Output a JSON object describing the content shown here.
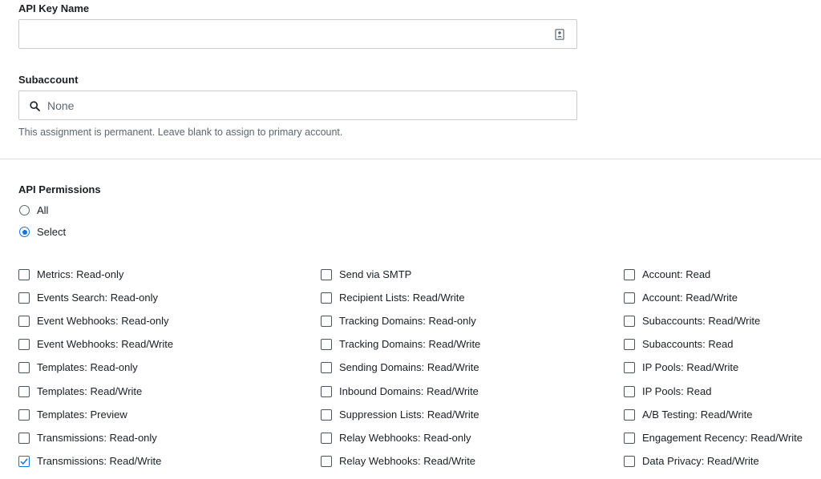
{
  "api_key_name": {
    "label": "API Key Name",
    "value": "",
    "placeholder": ""
  },
  "subaccount": {
    "label": "Subaccount",
    "placeholder": "None",
    "help_text": "This assignment is permanent. Leave blank to assign to primary account."
  },
  "permissions": {
    "heading": "API Permissions",
    "options": [
      {
        "label": "All",
        "selected": false
      },
      {
        "label": "Select",
        "selected": true
      }
    ],
    "columns": [
      [
        {
          "label": "Metrics: Read-only",
          "checked": false
        },
        {
          "label": "Events Search: Read-only",
          "checked": false
        },
        {
          "label": "Event Webhooks: Read-only",
          "checked": false
        },
        {
          "label": "Event Webhooks: Read/Write",
          "checked": false
        },
        {
          "label": "Templates: Read-only",
          "checked": false
        },
        {
          "label": "Templates: Read/Write",
          "checked": false
        },
        {
          "label": "Templates: Preview",
          "checked": false
        },
        {
          "label": "Transmissions: Read-only",
          "checked": false
        },
        {
          "label": "Transmissions: Read/Write",
          "checked": true
        }
      ],
      [
        {
          "label": "Send via SMTP",
          "checked": false
        },
        {
          "label": "Recipient Lists: Read/Write",
          "checked": false
        },
        {
          "label": "Tracking Domains: Read-only",
          "checked": false
        },
        {
          "label": "Tracking Domains: Read/Write",
          "checked": false
        },
        {
          "label": "Sending Domains: Read/Write",
          "checked": false
        },
        {
          "label": "Inbound Domains: Read/Write",
          "checked": false
        },
        {
          "label": "Suppression Lists: Read/Write",
          "checked": false
        },
        {
          "label": "Relay Webhooks: Read-only",
          "checked": false
        },
        {
          "label": "Relay Webhooks: Read/Write",
          "checked": false
        }
      ],
      [
        {
          "label": "Account: Read",
          "checked": false
        },
        {
          "label": "Account: Read/Write",
          "checked": false
        },
        {
          "label": "Subaccounts: Read/Write",
          "checked": false
        },
        {
          "label": "Subaccounts: Read",
          "checked": false
        },
        {
          "label": "IP Pools: Read/Write",
          "checked": false
        },
        {
          "label": "IP Pools: Read",
          "checked": false
        },
        {
          "label": "A/B Testing: Read/Write",
          "checked": false
        },
        {
          "label": "Engagement Recency: Read/Write",
          "checked": false
        },
        {
          "label": "Data Privacy: Read/Write",
          "checked": false
        }
      ]
    ]
  },
  "colors": {
    "accent": "#1273e6",
    "border": "#c5cbd1",
    "text": "#1a1f24",
    "muted": "#5b6670"
  },
  "icons": {
    "api_key_field": "contact-card-icon",
    "subaccount_field": "search-icon"
  }
}
